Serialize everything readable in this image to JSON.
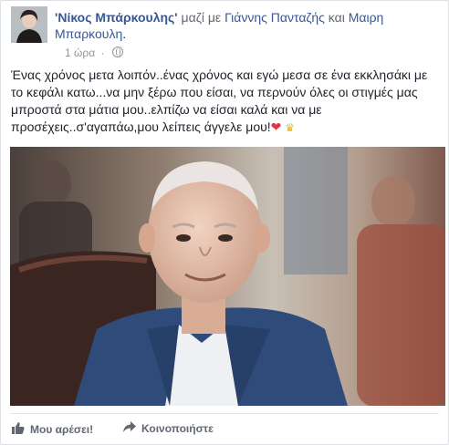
{
  "post": {
    "author": "'Νίκος Μπάρκουλης'",
    "with_text": "μαζί με",
    "tag1": "Γιάννης Πανταζής",
    "and_text": "και",
    "tag2": "Μαιρη Μπαρκουλη",
    "tag2_end": ".",
    "time": "1 ώρα",
    "dot": "·",
    "privacy_icon": "globe-icon",
    "body": "Ένας χρόνος μετα λοιπόν..ένας χρόνος και εγώ μεσα σε ένα εκκλησάκι με το κεφάλι κατω...να μην ξέρω που είσαι, να περνούν όλες οι στιγμές μας μπροστά στα μάτια μου..ελπίζω να είσαι καλά και να με προσέχεις..σ'αγαπάω,μου λείπεις άγγελε μου!",
    "emoji_heart": "❤",
    "emoji_crown": "♛"
  },
  "actions": {
    "like_label": "Μου αρέσει!",
    "share_label": "Κοινοποιήστε"
  },
  "colors": {
    "link": "#365899",
    "text": "#1d2129",
    "meta": "#90949c",
    "background": "#e9ebee"
  }
}
